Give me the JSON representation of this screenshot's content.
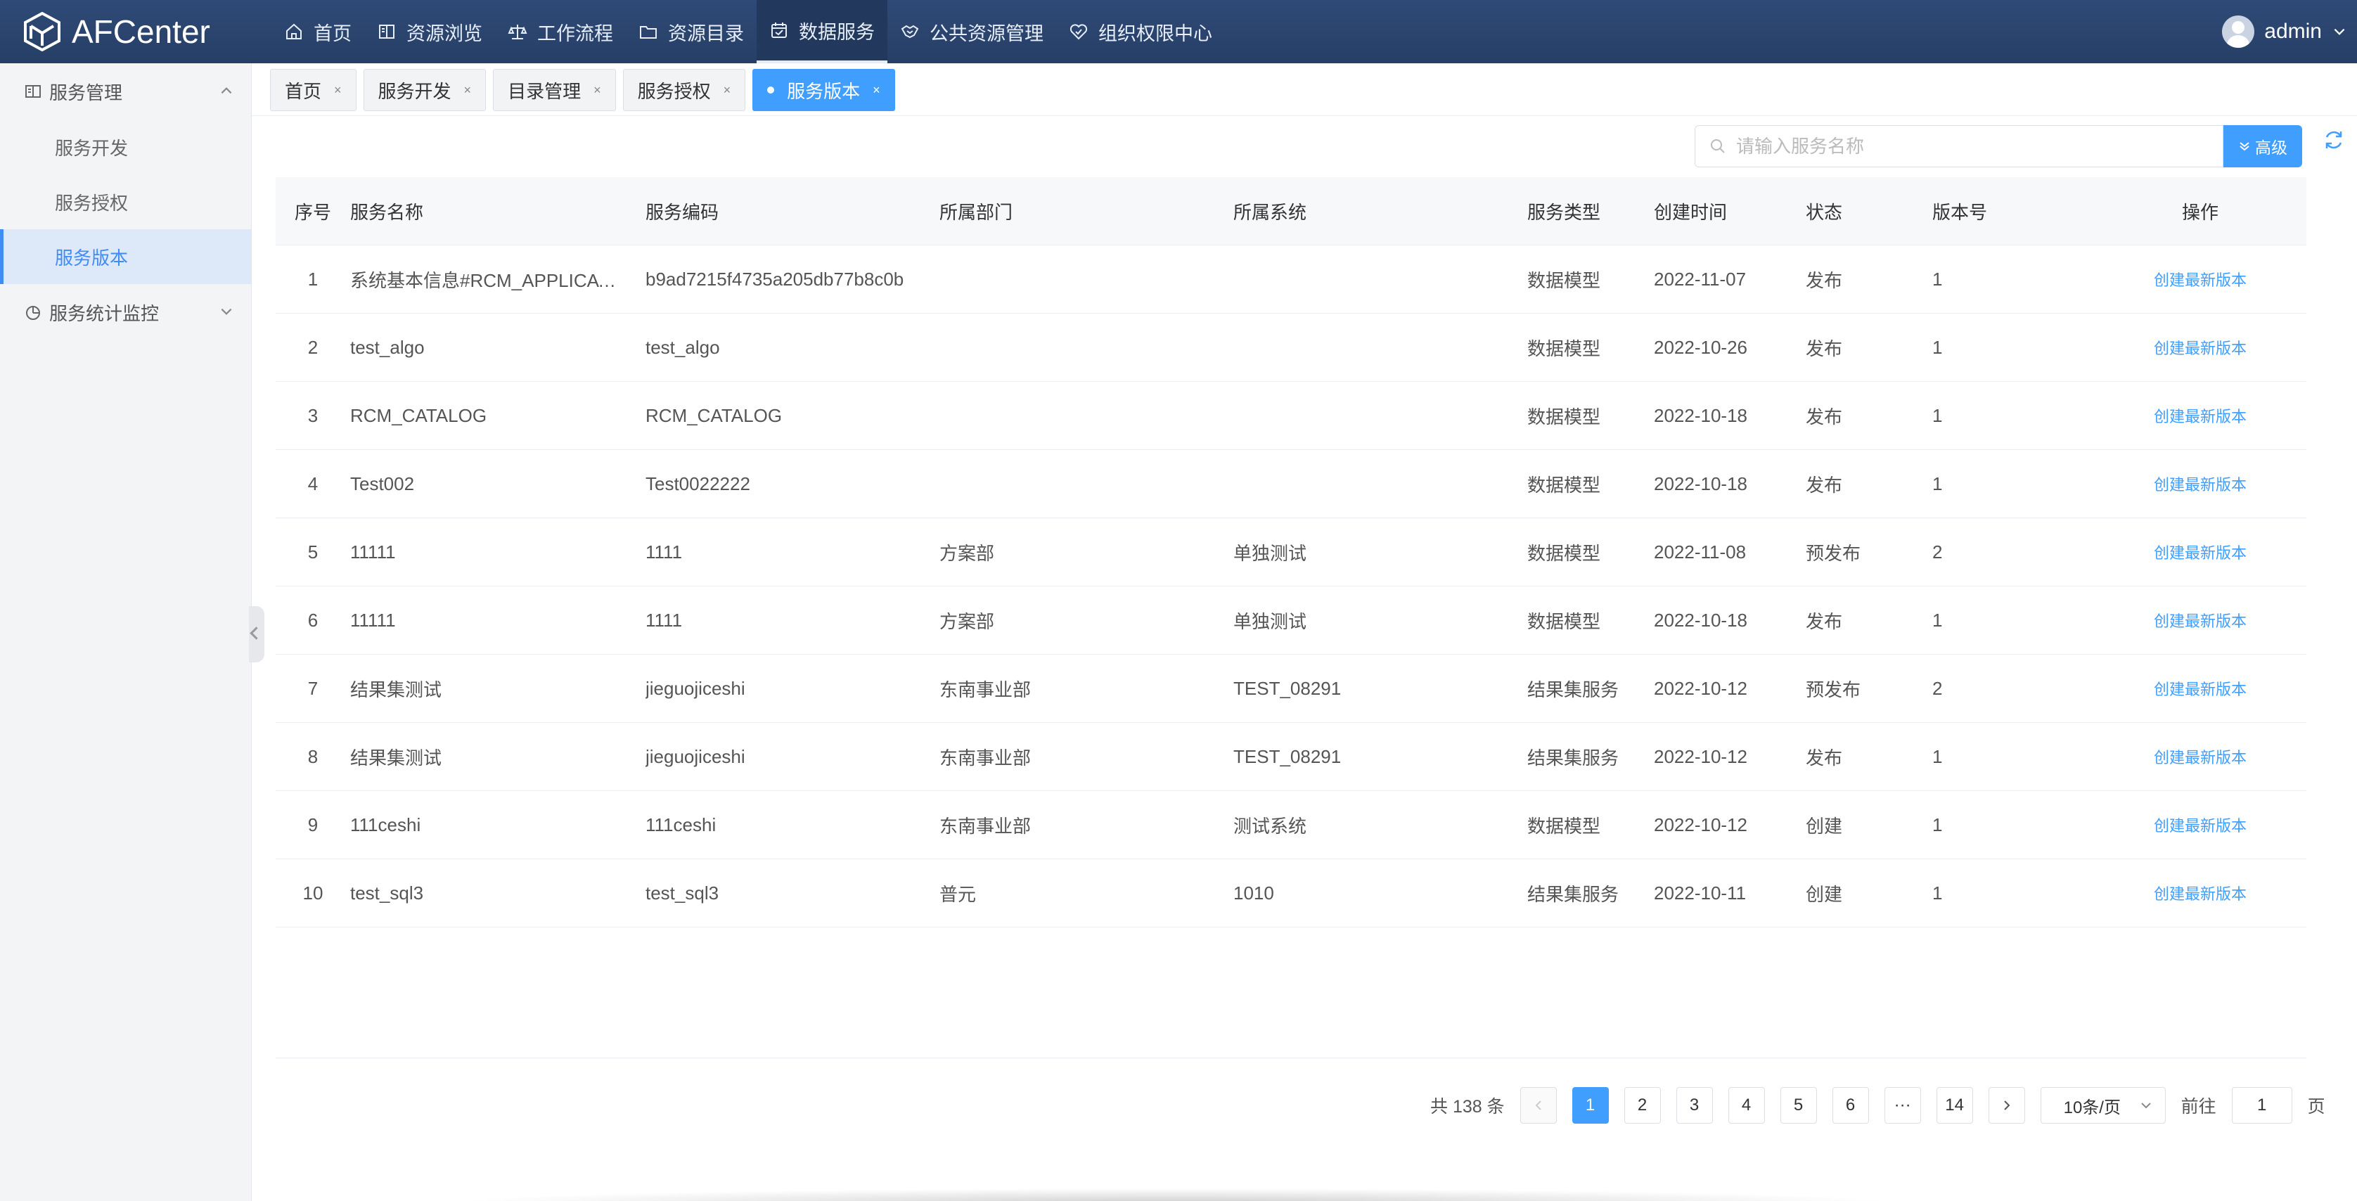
{
  "app": {
    "title": "AFCenter"
  },
  "nav": {
    "items": [
      {
        "label": "首页",
        "icon": "home-icon"
      },
      {
        "label": "资源浏览",
        "icon": "book-icon"
      },
      {
        "label": "工作流程",
        "icon": "scale-icon"
      },
      {
        "label": "资源目录",
        "icon": "folder-icon"
      },
      {
        "label": "数据服务",
        "icon": "calendar-check-icon",
        "active": true
      },
      {
        "label": "公共资源管理",
        "icon": "handshake-icon"
      },
      {
        "label": "组织权限中心",
        "icon": "heart-shield-icon"
      }
    ]
  },
  "user": {
    "name": "admin"
  },
  "sidebar": {
    "groups": [
      {
        "label": "服务管理",
        "expanded": true,
        "items": [
          "服务开发",
          "服务授权",
          "服务版本"
        ]
      },
      {
        "label": "服务统计监控",
        "expanded": false
      }
    ],
    "active_item": "服务版本"
  },
  "tabs": [
    {
      "label": "首页"
    },
    {
      "label": "服务开发"
    },
    {
      "label": "目录管理"
    },
    {
      "label": "服务授权"
    },
    {
      "label": "服务版本",
      "active": true
    }
  ],
  "tab_close": "×",
  "search": {
    "placeholder": "请输入服务名称",
    "value": ""
  },
  "advanced_button": "高级",
  "table": {
    "columns": [
      "序号",
      "服务名称",
      "服务编码",
      "所属部门",
      "所属系统",
      "服务类型",
      "创建时间",
      "状态",
      "版本号",
      "操作"
    ],
    "rows": [
      [
        "1",
        "系统基本信息#RCM_APPLICATION",
        "b9ad7215f4735a205db77b8c0b",
        "",
        "",
        "数据模型",
        "2022-11-07",
        "发布",
        "1",
        "创建最新版本"
      ],
      [
        "2",
        "test_algo",
        "test_algo",
        "",
        "",
        "数据模型",
        "2022-10-26",
        "发布",
        "1",
        "创建最新版本"
      ],
      [
        "3",
        "RCM_CATALOG",
        "RCM_CATALOG",
        "",
        "",
        "数据模型",
        "2022-10-18",
        "发布",
        "1",
        "创建最新版本"
      ],
      [
        "4",
        "Test002",
        "Test0022222",
        "",
        "",
        "数据模型",
        "2022-10-18",
        "发布",
        "1",
        "创建最新版本"
      ],
      [
        "5",
        "11111",
        "1111",
        "方案部",
        "单独测试",
        "数据模型",
        "2022-11-08",
        "预发布",
        "2",
        "创建最新版本"
      ],
      [
        "6",
        "11111",
        "1111",
        "方案部",
        "单独测试",
        "数据模型",
        "2022-10-18",
        "发布",
        "1",
        "创建最新版本"
      ],
      [
        "7",
        "结果集测试",
        "jieguojiceshi",
        "东南事业部",
        "TEST_08291",
        "结果集服务",
        "2022-10-12",
        "预发布",
        "2",
        "创建最新版本"
      ],
      [
        "8",
        "结果集测试",
        "jieguojiceshi",
        "东南事业部",
        "TEST_08291",
        "结果集服务",
        "2022-10-12",
        "发布",
        "1",
        "创建最新版本"
      ],
      [
        "9",
        "111ceshi",
        "111ceshi",
        "东南事业部",
        "测试系统",
        "数据模型",
        "2022-10-12",
        "创建",
        "1",
        "创建最新版本"
      ],
      [
        "10",
        "test_sql3",
        "test_sql3",
        "普元",
        "1010",
        "结果集服务",
        "2022-10-11",
        "创建",
        "1",
        "创建最新版本"
      ]
    ]
  },
  "pagination": {
    "total_text": "共 138 条",
    "pages": [
      "1",
      "2",
      "3",
      "4",
      "5",
      "6",
      "···",
      "14"
    ],
    "current": "1",
    "page_size": "10条/页",
    "goto_prefix": "前往",
    "goto_value": "1",
    "goto_suffix": "页"
  },
  "colors": {
    "primary": "#409eff",
    "topbar": "#2f4a77",
    "sidebar_active_bg": "#dde9f8"
  }
}
